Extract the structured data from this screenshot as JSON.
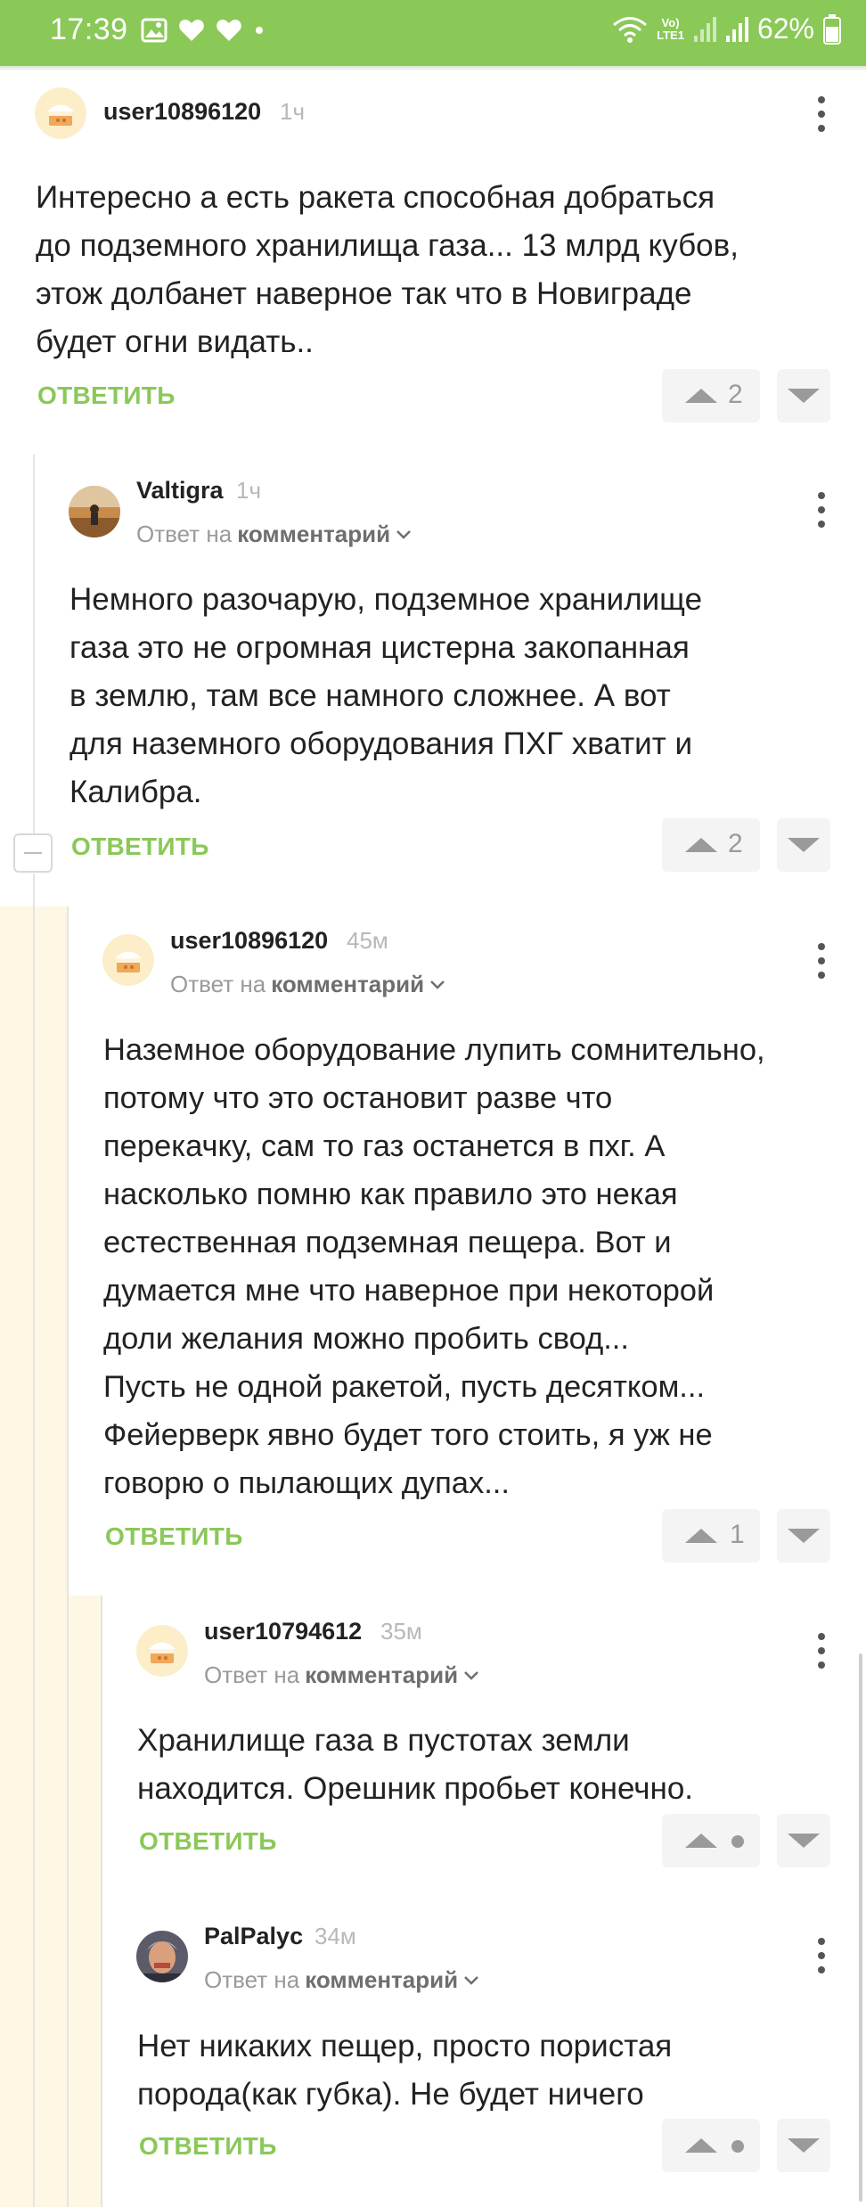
{
  "status_bar": {
    "time": "17:39",
    "battery": "62%",
    "net_top": "Vo)",
    "net_bottom": "LTE1",
    "bg_color": "#8ac858"
  },
  "comments": [
    {
      "username": "user10896120",
      "time": "1ч",
      "reply_prefix": "",
      "reply_target": "",
      "lines": [
        "Интересно а есть ракета способная добраться",
        "до подземного хранилища газа... 13 млрд кубов,",
        "этож долбанет наверное так что в Новиграде",
        "будет огни видать.."
      ],
      "reply_label": "ОТВЕТИТЬ",
      "votes": "2",
      "avatar": "cake-avatar"
    },
    {
      "username": "Valtigra",
      "time": "1ч",
      "reply_prefix": "Ответ на",
      "reply_target": "комментарий",
      "lines": [
        "Немного разочарую, подземное хранилище",
        "газа это не огромная цистерна закопанная",
        "в землю, там все намного сложнее. А вот",
        "для наземного оборудования ПХГ хватит и",
        "Калибра."
      ],
      "reply_label": "ОТВЕТИТЬ",
      "votes": "2",
      "avatar": "photo-avatar"
    },
    {
      "username": "user10896120",
      "time": "45м",
      "reply_prefix": "Ответ на",
      "reply_target": "комментарий",
      "lines": [
        "Наземное оборудование лупить сомнительно,",
        "потому что это остановит разве что",
        "перекачку, сам то газ останется в пхг. А",
        "насколько помню как правило это некая",
        "естественная подземная пещера. Вот и",
        "думается мне что наверное при некоторой",
        "доли желания можно пробить свод...",
        "Пусть не одной ракетой, пусть десятком...",
        "Фейерверк явно будет того стоить, я уж не",
        "говорю о пылающих дупах..."
      ],
      "reply_label": "ОТВЕТИТЬ",
      "votes": "1",
      "avatar": "cake-avatar"
    },
    {
      "username": "user10794612",
      "time": "35м",
      "reply_prefix": "Ответ на",
      "reply_target": "комментарий",
      "lines": [
        "Хранилище газа в пустотах земли",
        "находится. Орешник пробьет конечно."
      ],
      "reply_label": "ОТВЕТИТЬ",
      "votes": "",
      "avatar": "cake-avatar"
    },
    {
      "username": "PalPalyc",
      "time": "34м",
      "reply_prefix": "Ответ на",
      "reply_target": "комментарий",
      "lines": [
        "Нет никаких пещер, просто пористая",
        "порода(как губка). Не будет ничего"
      ],
      "reply_label": "ОТВЕТИТЬ",
      "votes": "",
      "avatar": "portrait-avatar"
    }
  ],
  "colors": {
    "accent": "#8ac858",
    "thread_highlight": "#fdf7e3",
    "muted": "#9a9a9a"
  }
}
